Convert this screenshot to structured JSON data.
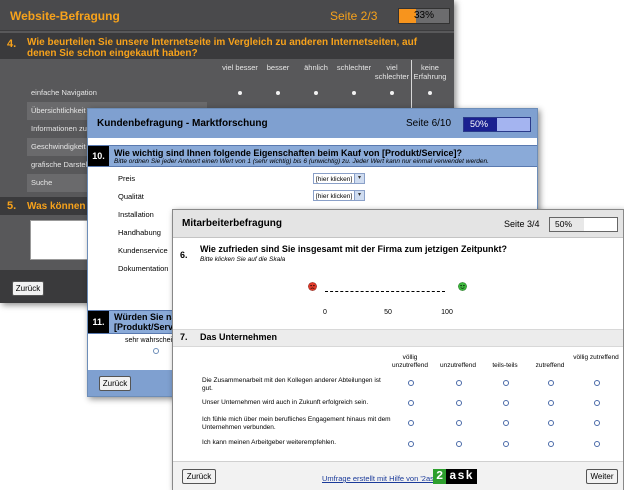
{
  "survey1": {
    "title": "Website-Befragung",
    "page_label": "Seite 2/3",
    "progress_text": "33%",
    "progress_fraction": 0.33,
    "q4_number": "4.",
    "q4_text": "Wie beurteilen Sie unsere Internetseite im Vergleich zu anderen Internetseiten, auf denen Sie schon eingekauft haben?",
    "columns": [
      "viel besser",
      "besser",
      "ähnlich",
      "schlechter",
      "viel schlechter",
      "keine Erfahrung"
    ],
    "rows": [
      "einfache Navigation",
      "Übersichtlichkeit",
      "Informationen zu e",
      "Geschwindigkeit",
      "grafische Darstellu",
      "Suche"
    ],
    "q5_number": "5.",
    "q5_text": "Was können wi",
    "back_label": "Zurück"
  },
  "survey2": {
    "title": "Kundenbefragung - Marktforschung",
    "page_label": "Seite 6/10",
    "progress_text": "50%",
    "progress_fraction": 0.5,
    "q10_number": "10.",
    "q10_text": "Wie wichtig sind Ihnen folgende Eigenschaften beim Kauf von [Produkt/Service]?",
    "q10_sub": "Bitte ordnen Sie jeder Antwort einen Wert von 1 (sehr wichtig) bis 6 (unwichtig) zu. Jeder Wert kann nur einmal verwendet werden.",
    "items": [
      "Preis",
      "Qualität",
      "Installation",
      "Handhabung",
      "Kundenservice",
      "Dokumentation"
    ],
    "select_value": "[hier klicken]",
    "q11_number": "11.",
    "q11_line1": "Würden Sie nac",
    "q11_line2": "[Produkt/Service",
    "q11_option": "sehr wahrschein",
    "back_label": "Zurück"
  },
  "survey3": {
    "title": "Mitarbeiterbefragung",
    "page_label": "Seite 3/4",
    "progress_text": "50%",
    "progress_fraction": 0.5,
    "q6_number": "6.",
    "q6_text": "Wie zufrieden sind Sie insgesamt mit der Firma zum jetzigen Zeitpunkt?",
    "q6_sub": "Bitte klicken Sie auf die Skala",
    "scale_ticks": [
      "0",
      "50",
      "100"
    ],
    "q7_number": "7.",
    "q7_text": "Das Unternehmen",
    "columns": [
      "völlig unzutreffend",
      "unzutreffend",
      "teils-teils",
      "zutreffend",
      "völlig zutreffend"
    ],
    "statements": [
      "Die Zusammenarbeit mit den Kollegen anderer Abteilungen ist gut.",
      "Unser Unternehmen wird auch in Zukunft erfolgreich sein.",
      "Ich fühle mich über mein berufliches Engagement hinaus mit dem Unternehmen verbunden.",
      "Ich kann meinen Arbeitgeber weiterempfehlen."
    ],
    "back_label": "Zurück",
    "credit": "Umfrage erstellt mit Hilfe von '2ask'",
    "logo_num": "2",
    "logo_text": "ask",
    "next_label": "Weiter"
  },
  "colors": {
    "accent_orange": "#f7a21b",
    "blue_header": "#7fa0d0",
    "progress_navy": "#1a2090",
    "logo_green": "#2d9f2d"
  }
}
